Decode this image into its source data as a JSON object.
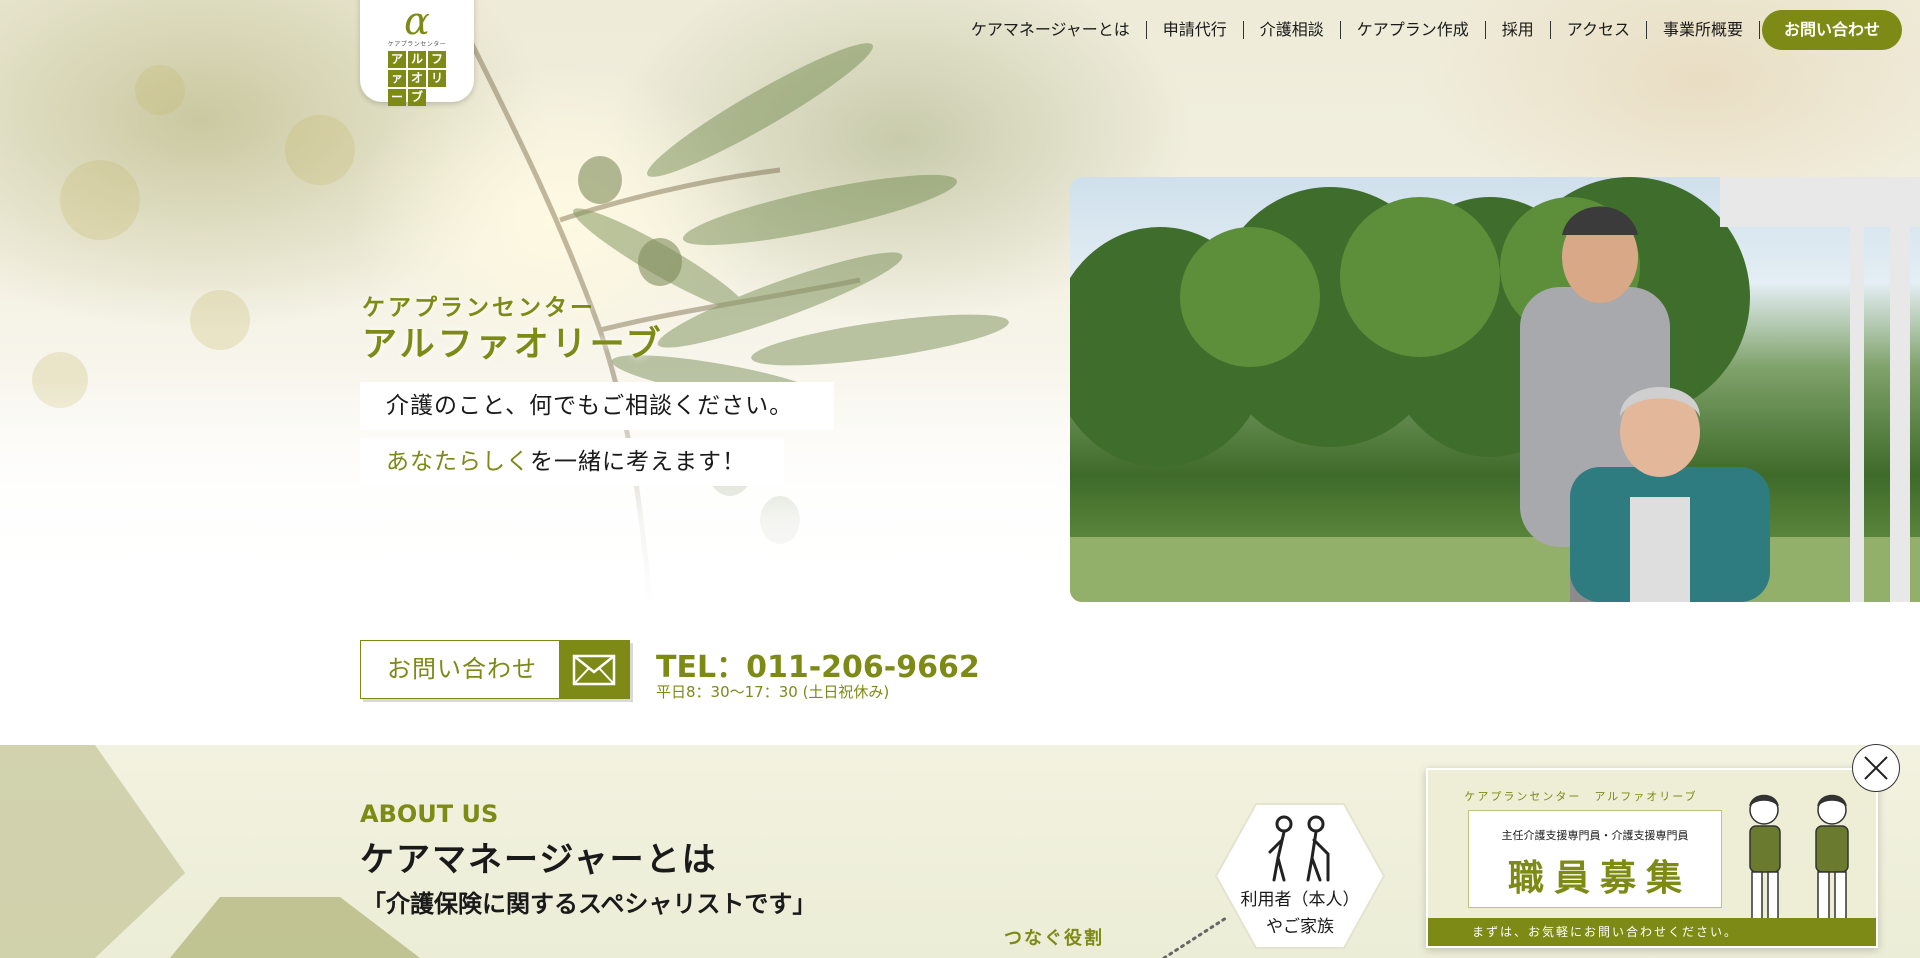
{
  "logo": {
    "alpha": "α",
    "small_text": "ケアプランセンター",
    "cells": [
      "ア",
      "ル",
      "フ",
      "ァ",
      "オ",
      "リ",
      "ー",
      "ブ"
    ]
  },
  "nav": {
    "items": [
      {
        "label": "ケアマネージャーとは"
      },
      {
        "label": "申請代行"
      },
      {
        "label": "介護相談"
      },
      {
        "label": "ケアプラン作成"
      },
      {
        "label": "採用"
      },
      {
        "label": "アクセス"
      },
      {
        "label": "事業所概要"
      }
    ],
    "cta": "お問い合わせ"
  },
  "hero": {
    "subtitle": "ケアプランセンター",
    "title": "アルファオリーブ",
    "tagline1": "介護のこと、何でもご相談ください。",
    "tagline2_accent": "あなたらしく",
    "tagline2_rest": "を一緒に考えます！"
  },
  "contact": {
    "button_label": "お問い合わせ",
    "tel": "TEL：011-206-9662",
    "hours": "平日8：30〜17：30 (土日祝休み)"
  },
  "about": {
    "en_label": "ABOUT US",
    "title": "ケアマネージャーとは",
    "subtitle": "「介護保険に関するスペシャリストです」",
    "role_label": "つなぐ役割",
    "user_line1": "利用者（本人）",
    "user_line2": "やご家族"
  },
  "banner": {
    "header": "ケアプランセンター　アルファオリーブ",
    "role": "主任介護支援専門員・介護支援専門員",
    "title": "職員募集",
    "footer": "まずは、お気軽にお問い合わせください。"
  },
  "colors": {
    "accent": "#7d8a16",
    "accent_light": "#bfc37e",
    "section_bg": "#eeeed6"
  },
  "icons": {
    "contact": "mail-icon",
    "close": "close-icon",
    "user_group": "elderly-couple-icon"
  }
}
